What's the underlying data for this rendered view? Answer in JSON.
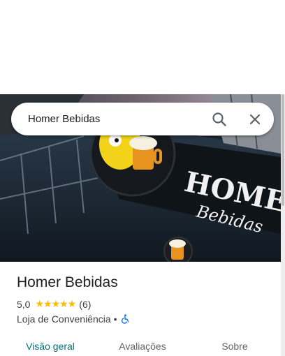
{
  "search": {
    "value": "Homer Bebidas",
    "search_icon": "search-icon",
    "clear_icon": "close-icon"
  },
  "hero": {
    "sign_text": "HOMER",
    "sign_script": "Bebidas"
  },
  "place": {
    "name": "Homer Bebidas",
    "rating": "5,0",
    "stars": 5,
    "review_count": "(6)",
    "category": "Loja de Conveniência",
    "separator": "•",
    "accessibility_icon": "wheelchair-icon"
  },
  "tabs": [
    {
      "label": "Visão geral",
      "active": true
    },
    {
      "label": "Avaliações",
      "active": false
    },
    {
      "label": "Sobre",
      "active": false
    }
  ],
  "colors": {
    "star": "#fbbc04",
    "active_tab": "#00707c",
    "accessibility": "#1a73e8"
  }
}
